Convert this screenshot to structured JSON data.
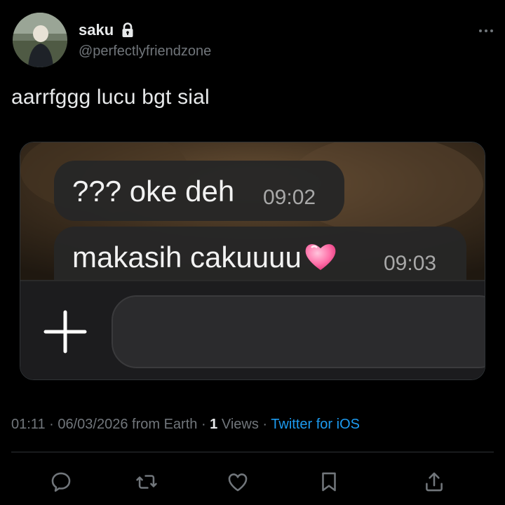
{
  "author": {
    "display_name": "saku",
    "handle": "@perfectlyfriendzone",
    "protected": true
  },
  "tweet": {
    "text": "aarrfggg lucu bgt sial"
  },
  "media": {
    "messages": [
      {
        "text": "??? oke deh",
        "time": "09:02"
      },
      {
        "text": "makasih cakuuuu",
        "time": "09:03",
        "emoji": "pink-heart-icon"
      }
    ],
    "composer_icon": "plus-icon"
  },
  "meta": {
    "time": "01:11",
    "date": "06/03/2026",
    "location": "from Earth",
    "views_count": "1",
    "views_label": "Views",
    "source": "Twitter for iOS"
  },
  "actions": [
    "reply-icon",
    "retweet-icon",
    "like-icon",
    "bookmark-icon",
    "share-icon"
  ],
  "colors": {
    "background": "#000000",
    "text": "#e7e9ea",
    "muted": "#71767b",
    "link": "#1d9bf0",
    "bubble": "#262626"
  }
}
